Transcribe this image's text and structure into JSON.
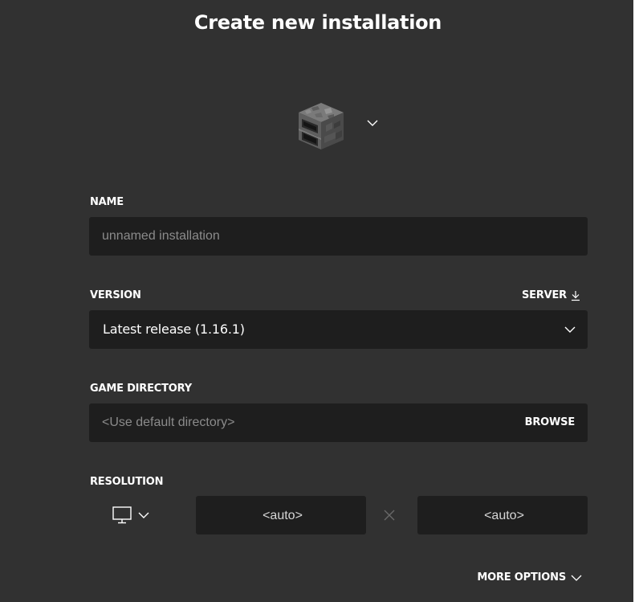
{
  "dialog": {
    "title": "Create new installation"
  },
  "icon_picker": {
    "selected_icon": "furnace-icon"
  },
  "name_field": {
    "label": "NAME",
    "value": "",
    "placeholder": "unnamed installation"
  },
  "version_field": {
    "label": "VERSION",
    "server_link": "SERVER",
    "selected": "Latest release (1.16.1)"
  },
  "directory_field": {
    "label": "GAME DIRECTORY",
    "value": "",
    "placeholder": "<Use default directory>",
    "browse_label": "BROWSE"
  },
  "resolution": {
    "label": "RESOLUTION",
    "preset_icon": "monitor-icon",
    "width_placeholder": "<auto>",
    "height_placeholder": "<auto>",
    "separator": "×"
  },
  "more_options": {
    "label": "MORE OPTIONS"
  },
  "colors": {
    "panel_background": "#313131",
    "field_background": "#1e1e1e",
    "text": "#ffffff",
    "placeholder": "#8b8b8b"
  }
}
